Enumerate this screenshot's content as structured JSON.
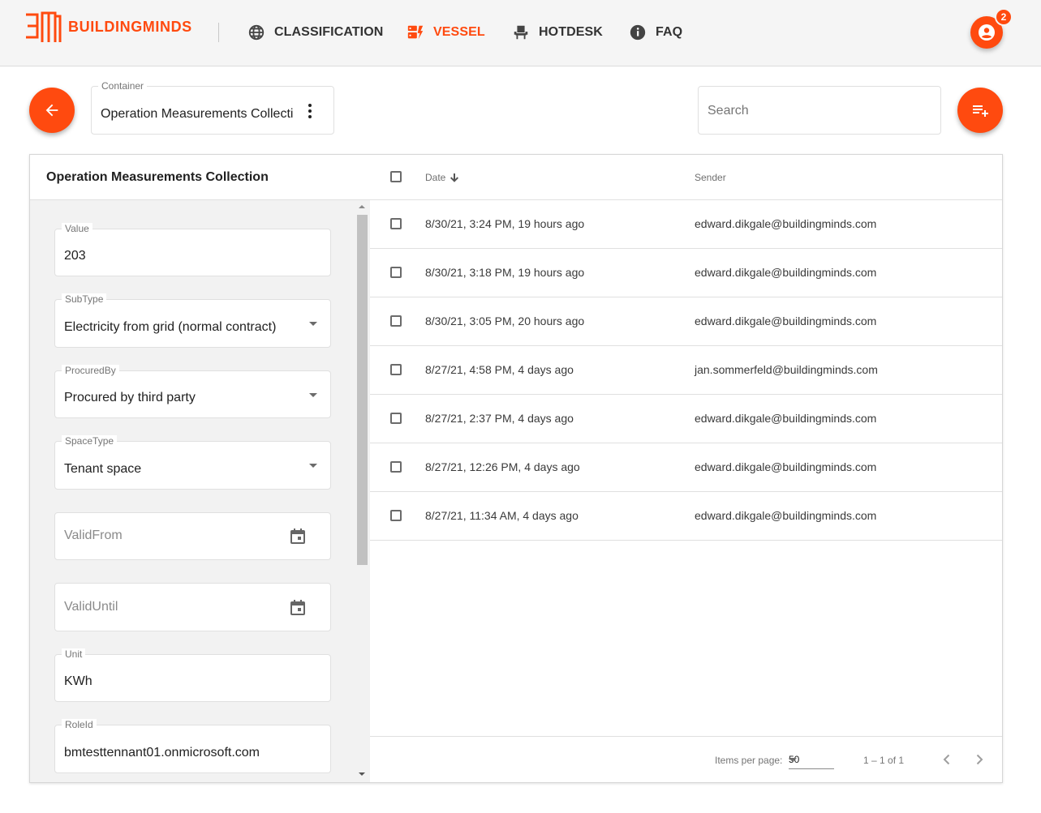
{
  "app": {
    "brand": "BUILDINGMINDS",
    "brand_color": "#ff4a0f",
    "notification_count": "2"
  },
  "nav": [
    {
      "label": "CLASSIFICATION",
      "icon": "globe-icon",
      "active": false
    },
    {
      "label": "VESSEL",
      "icon": "vessel-icon",
      "active": true
    },
    {
      "label": "HOTDESK",
      "icon": "desk-chair-icon",
      "active": false
    },
    {
      "label": "FAQ",
      "icon": "info-icon",
      "active": false
    }
  ],
  "toolbar": {
    "container_label": "Container",
    "container_value": "Operation Measurements Collecti",
    "search_placeholder": "Search"
  },
  "detail": {
    "title": "Operation Measurements Collection",
    "fields": [
      {
        "label": "Value",
        "value": "203",
        "kind": "text"
      },
      {
        "label": "SubType",
        "value": "Electricity from grid (normal contract)",
        "kind": "select"
      },
      {
        "label": "ProcuredBy",
        "value": "Procured by third party",
        "kind": "select"
      },
      {
        "label": "SpaceType",
        "value": "Tenant space",
        "kind": "select"
      },
      {
        "label": "",
        "placeholder": "ValidFrom",
        "value": "",
        "kind": "date"
      },
      {
        "label": "",
        "placeholder": "ValidUntil",
        "value": "",
        "kind": "date"
      },
      {
        "label": "Unit",
        "value": "KWh",
        "kind": "text"
      },
      {
        "label": "RoleId",
        "value": "bmtesttennant01.onmicrosoft.com",
        "kind": "text"
      }
    ]
  },
  "table": {
    "columns": {
      "date": "Date",
      "sender": "Sender"
    },
    "rows": [
      {
        "date": "8/30/21, 3:24 PM, 19 hours ago",
        "sender": "edward.dikgale@buildingminds.com"
      },
      {
        "date": "8/30/21, 3:18 PM, 19 hours ago",
        "sender": "edward.dikgale@buildingminds.com"
      },
      {
        "date": "8/30/21, 3:05 PM, 20 hours ago",
        "sender": "edward.dikgale@buildingminds.com"
      },
      {
        "date": "8/27/21, 4:58 PM, 4 days ago",
        "sender": "jan.sommerfeld@buildingminds.com"
      },
      {
        "date": "8/27/21, 2:37 PM, 4 days ago",
        "sender": "edward.dikgale@buildingminds.com"
      },
      {
        "date": "8/27/21, 12:26 PM, 4 days ago",
        "sender": "edward.dikgale@buildingminds.com"
      },
      {
        "date": "8/27/21, 11:34 AM, 4 days ago",
        "sender": "edward.dikgale@buildingminds.com"
      }
    ]
  },
  "paginator": {
    "items_per_page_label": "Items per page:",
    "page_size": "50",
    "range": "1 – 1 of 1"
  }
}
